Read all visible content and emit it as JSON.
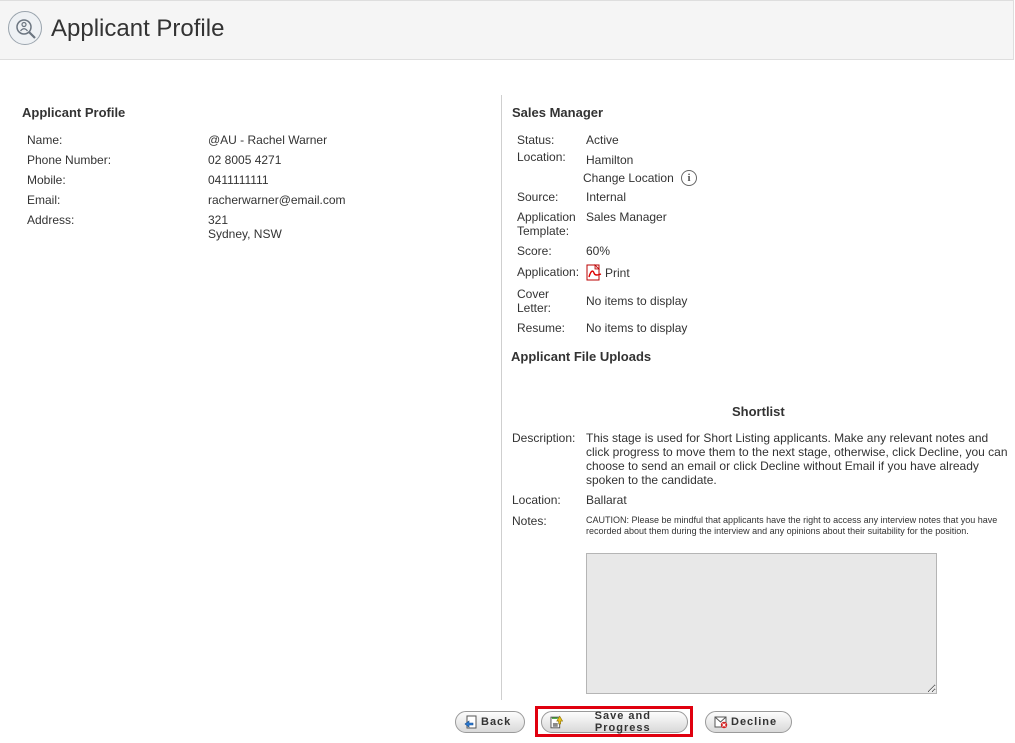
{
  "header": {
    "title": "Applicant Profile",
    "icon": "applicant-search-icon"
  },
  "profile": {
    "title": "Applicant Profile",
    "fields": [
      {
        "label": "Name:",
        "value": "@AU - Rachel Warner"
      },
      {
        "label": "Phone Number:",
        "value": "02 8005 4271"
      },
      {
        "label": "Mobile:",
        "value": "0411111111"
      },
      {
        "label": "Email:",
        "value": "racherwarner@email.com"
      },
      {
        "label": "Address:",
        "value": "321",
        "value2": "Sydney, NSW"
      }
    ]
  },
  "job": {
    "title": "Sales Manager",
    "status_label": "Status:",
    "status_value": "Active",
    "location_label": "Location:",
    "location_value": "Hamilton",
    "change_location": "Change Location",
    "source_label": "Source:",
    "source_value": "Internal",
    "template_label_1": "Application",
    "template_label_2": "Template:",
    "template_value": "Sales Manager",
    "score_label": "Score:",
    "score_value": "60%",
    "application_label": "Application:",
    "print_label": "Print",
    "cover_label_1": "Cover",
    "cover_label_2": "Letter:",
    "cover_value": "No items to display",
    "resume_label": "Resume:",
    "resume_value": "No items to display"
  },
  "uploads": {
    "title": "Applicant File Uploads"
  },
  "stage": {
    "title": "Shortlist",
    "description_label": "Description:",
    "description": "This stage is used for Short Listing applicants. Make any relevant notes and click progress to move them to the next stage, otherwise, click Decline, you can choose to send an email or click Decline without Email if you have already spoken to the candidate.",
    "location_label": "Location:",
    "location_value": "Ballarat",
    "notes_label": "Notes:",
    "caution": "CAUTION: Please be mindful that applicants have the right to access any interview notes that you have recorded about them during the interview and any opinions about their suitability for the position.",
    "notes_value": ""
  },
  "buttons": {
    "back": "Back",
    "save": "Save and Progress",
    "decline": "Decline"
  },
  "colors": {
    "highlight": "#e0000f",
    "header_bg": "#f5f5f5",
    "notes_bg": "#e8e8e8"
  }
}
